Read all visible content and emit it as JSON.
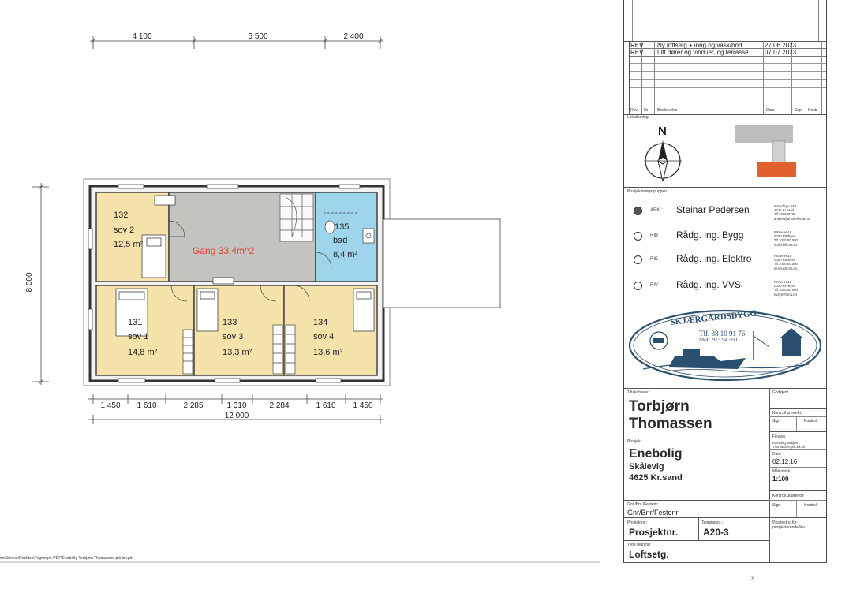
{
  "plan": {
    "top_dims": [
      "4 100",
      "5 500",
      "2 400"
    ],
    "bottom_dims": [
      "1 450",
      "1 610",
      "2 285",
      "1 310",
      "2 284",
      "1 610",
      "1 450"
    ],
    "total_width": "12 000",
    "height_dim": "8 000",
    "rooms": [
      {
        "number": "132",
        "name": "sov 2",
        "area": "12,5 m²"
      },
      {
        "number": "135",
        "name": "bad",
        "area": "8,4 m²"
      },
      {
        "number": "131",
        "name": "sov 1",
        "area": "14,8 m²"
      },
      {
        "number": "133",
        "name": "sov 3",
        "area": "13,3 m²"
      },
      {
        "number": "134",
        "name": "sov 4",
        "area": "13,6 m²"
      }
    ],
    "gang_label": "Gang 33,4m^2",
    "file_path": "en\\Steinar\\Desktop\\Tegninger PDF\\Enebolig Torbjørn Thomassen.pln.lck.pln"
  },
  "revisions": {
    "rows": [
      {
        "code": "REV",
        "text": "Ny loftsetg.+ inng.og vask/bod",
        "date": "27.06.2023"
      },
      {
        "code": "REV",
        "text": "Litt dører og vinduer, og terrasse",
        "date": "07.07.2023"
      }
    ],
    "headers": {
      "rev": "Rev",
      "nr": "Nr",
      "desc": "Beskrivelse",
      "date": "Dato",
      "sign": "Sign",
      "kontr": "Kontr"
    }
  },
  "location": {
    "label": "Lokalisering:",
    "north": "N"
  },
  "group": {
    "label": "Prosjekteringsgruppen",
    "members": [
      {
        "code": "ARK :",
        "name": "Steinar Pedersen",
        "info": [
          "Østeråsye 240",
          "4625 Kr.sand",
          "Tlf.: 90522760",
          "andeis@arkolelfirma.no"
        ],
        "selected": true
      },
      {
        "code": "RIB :",
        "name": "Rådg. ing. Bygg",
        "info": [
          "RIBveien18",
          "0000 RIBbyen",
          "Tlf.: 000 00 000",
          "rib@ribfirma.no"
        ],
        "selected": false
      },
      {
        "code": "RIE :",
        "name": "Rådg. ing. Elektro",
        "info": [
          "RIEveien18",
          "0000 RIEbyen",
          "Tlf.: 000 00 000",
          "rie@riefirma.no"
        ],
        "selected": false
      },
      {
        "code": "RIV :",
        "name": "Rådg. ing. VVS",
        "info": [
          "RIVveien18",
          "0000 RIVbyen",
          "Tlf.: 000 00 000",
          "riv@rivfirma.no"
        ],
        "selected": false
      }
    ]
  },
  "logo": {
    "name": "SKJÆRGÅRDSBYGG",
    "tel": "Tlf. 38 10 91 76",
    "mob": "Mob. 915 94 500"
  },
  "owner": {
    "label": "Tiltakshaver",
    "first": "Torbjørn",
    "last": "Thomassen"
  },
  "project": {
    "label": "Prosjekt",
    "title": "Enebolig",
    "place": "Skålevig",
    "postal": "4625 Kr.sand"
  },
  "approval": {
    "godkjent": "Godkjent",
    "kontroll_prosjekt": "Kontroll prosjekt.",
    "sign": "Sign.",
    "kontroll": "Kontroll",
    "filnavn_label": "Filnavn",
    "filnavn_value": [
      "Enebolig Torbjørn",
      "Thomassen.pln.lck.pln"
    ],
    "dato_label": "Dato",
    "dato_value": "02.12.16",
    "malestokk_label": "Målestokk",
    "malestokk_value": "1:100",
    "kontroll_utforende": "Kontroll utførende",
    "sign2": "Sign.",
    "kontroll2": "Kontroll"
  },
  "gnr": {
    "label": "Gnr./Bnr./Festenr.:",
    "value": "Gnr/Bnr/Festenr"
  },
  "prosjektnr": {
    "label": "Prosjektnr.:",
    "value": "Prosjektnr."
  },
  "tegningsnr": {
    "label": "Tegningsnr.:",
    "value": "A20-3"
  },
  "prosjektnr_for": {
    "label": "Prosjektnr. for prosjekterende/lev."
  },
  "type": {
    "label": "Type tegning:",
    "value": "Loftsetg."
  },
  "footer_mark": "»"
}
